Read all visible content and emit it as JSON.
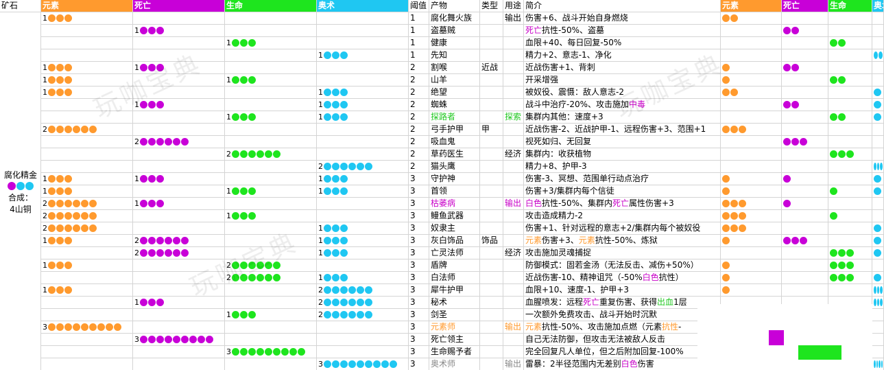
{
  "colors": {
    "yuansu": "#ff9a2e",
    "siwang": "#c800d8",
    "shengming": "#1ee51e",
    "aoshu": "#1fc7f2",
    "header_yuansu": "#ff9a2e",
    "header_siwang": "#c800d8",
    "header_shengming": "#1ee51e",
    "header_aoshu": "#1fc7f2"
  },
  "headers": {
    "ore": "矿石",
    "yuansu": "元素",
    "siwang": "死亡",
    "shengming": "生命",
    "aoshu": "奥术",
    "threshold": "阈值",
    "product": "产物",
    "type": "类型",
    "use": "用途",
    "desc": "简介",
    "r_yuansu": "元素",
    "r_siwang": "死亡",
    "r_shengming": "生命",
    "r_aoshu": "奥术"
  },
  "ore": {
    "name": "腐化精金",
    "combine_label": "合成：",
    "combine_value": "4山铜"
  },
  "watermark": "玩咖宝典",
  "rows": [
    {
      "e": 1,
      "d": 0,
      "l": 0,
      "a": 0,
      "t": "1",
      "p": "腐化舞火族",
      "pc": "",
      "ty": "",
      "u": "输出",
      "uc": "",
      "ds": [
        [
          "伤害+6、战斗开始自身燃烧",
          ""
        ]
      ],
      "re": 2,
      "rd": 0,
      "rl": 0,
      "ra": 0
    },
    {
      "e": 0,
      "d": 1,
      "l": 0,
      "a": 0,
      "t": "1",
      "p": "盗墓贼",
      "pc": "",
      "ty": "",
      "u": "",
      "uc": "",
      "ds": [
        [
          "死亡",
          "purple"
        ],
        [
          "抗性-50%、盗墓",
          ""
        ]
      ],
      "re": 0,
      "rd": 2,
      "rl": 0,
      "ra": 0
    },
    {
      "e": 0,
      "d": 0,
      "l": 1,
      "a": 0,
      "t": "1",
      "p": "健康",
      "pc": "",
      "ty": "",
      "u": "",
      "uc": "",
      "ds": [
        [
          "血限+40、每日回复-50%",
          ""
        ]
      ],
      "re": 0,
      "rd": 0,
      "rl": 2,
      "ra": 0
    },
    {
      "e": 0,
      "d": 0,
      "l": 0,
      "a": 1,
      "t": "1",
      "p": "先知",
      "pc": "",
      "ty": "",
      "u": "",
      "uc": "",
      "ds": [
        [
          "精力+2、意志-1、净化",
          ""
        ]
      ],
      "re": 0,
      "rd": 0,
      "rl": 0,
      "ra": 2
    },
    {
      "e": 1,
      "d": 1,
      "l": 0,
      "a": 0,
      "t": "2",
      "p": "割喉",
      "pc": "",
      "ty": "近战",
      "u": "",
      "uc": "",
      "ds": [
        [
          "近战伤害+1、背刺",
          ""
        ]
      ],
      "re": 1,
      "rd": 2,
      "rl": 0,
      "ra": 0
    },
    {
      "e": 1,
      "d": 0,
      "l": 1,
      "a": 0,
      "t": "2",
      "p": "山羊",
      "pc": "",
      "ty": "",
      "u": "",
      "uc": "",
      "ds": [
        [
          "开采增强",
          ""
        ]
      ],
      "re": 1,
      "rd": 0,
      "rl": 2,
      "ra": 0
    },
    {
      "e": 1,
      "d": 0,
      "l": 0,
      "a": 1,
      "t": "2",
      "p": "绝望",
      "pc": "",
      "ty": "",
      "u": "",
      "uc": "",
      "ds": [
        [
          "被奴役、震慑：敌人意志-2",
          ""
        ]
      ],
      "re": 2,
      "rd": 0,
      "rl": 0,
      "ra": 1
    },
    {
      "e": 0,
      "d": 1,
      "l": 0,
      "a": 1,
      "t": "2",
      "p": "蜘蛛",
      "pc": "",
      "ty": "",
      "u": "",
      "uc": "",
      "ds": [
        [
          "战斗中治疗-20%、攻击施加",
          ""
        ],
        [
          "中毒",
          "purple"
        ]
      ],
      "re": 0,
      "rd": 2,
      "rl": 0,
      "ra": 1
    },
    {
      "e": 0,
      "d": 0,
      "l": 1,
      "a": 1,
      "t": "2",
      "p": "探路者",
      "pc": "green",
      "ty": "",
      "u": "探索",
      "uc": "green",
      "ds": [
        [
          "集群内其他：速度+3",
          ""
        ]
      ],
      "re": 0,
      "rd": 0,
      "rl": 2,
      "ra": 1
    },
    {
      "e": 2,
      "d": 0,
      "l": 0,
      "a": 0,
      "t": "2",
      "p": "弓手护甲",
      "pc": "",
      "ty": "甲",
      "u": "",
      "uc": "",
      "ds": [
        [
          "近战伤害-2、近战护甲-1、远程伤害+3、范围+1",
          ""
        ]
      ],
      "re": 3,
      "rd": 0,
      "rl": 0,
      "ra": 0
    },
    {
      "e": 0,
      "d": 2,
      "l": 0,
      "a": 0,
      "t": "2",
      "p": "吸血鬼",
      "pc": "",
      "ty": "",
      "u": "",
      "uc": "",
      "ds": [
        [
          "视死如归、无回复",
          ""
        ]
      ],
      "re": 0,
      "rd": 3,
      "rl": 0,
      "ra": 0
    },
    {
      "e": 0,
      "d": 0,
      "l": 2,
      "a": 0,
      "t": "2",
      "p": "草药医生",
      "pc": "",
      "ty": "",
      "u": "经济",
      "uc": "",
      "ds": [
        [
          "集群内：收获植物",
          ""
        ]
      ],
      "re": 0,
      "rd": 0,
      "rl": 3,
      "ra": 0
    },
    {
      "e": 0,
      "d": 0,
      "l": 0,
      "a": 2,
      "t": "2",
      "p": "猫头鹰",
      "pc": "",
      "ty": "",
      "u": "",
      "uc": "",
      "ds": [
        [
          "精力+8、护甲-3",
          ""
        ]
      ],
      "re": 0,
      "rd": 0,
      "rl": 0,
      "ra": 3
    },
    {
      "e": 1,
      "d": 1,
      "l": 0,
      "a": 1,
      "t": "3",
      "p": "守护神",
      "pc": "",
      "ty": "",
      "u": "",
      "uc": "",
      "ds": [
        [
          "伤害-3、冥想、范围单行动点治疗",
          ""
        ]
      ],
      "re": 1,
      "rd": 1,
      "rl": 0,
      "ra": 1
    },
    {
      "e": 1,
      "d": 0,
      "l": 1,
      "a": 1,
      "t": "3",
      "p": "首领",
      "pc": "",
      "ty": "",
      "u": "",
      "uc": "",
      "ds": [
        [
          "伤害+3/集群内每个信徒",
          ""
        ]
      ],
      "re": 1,
      "rd": 0,
      "rl": 1,
      "ra": 1
    },
    {
      "e": 2,
      "d": 1,
      "l": 0,
      "a": 0,
      "t": "3",
      "p": "枯萎病",
      "pc": "purple",
      "ty": "",
      "u": "输出",
      "uc": "purple",
      "ds": [
        [
          "白色",
          "purple"
        ],
        [
          "抗性-50%、集群内",
          ""
        ],
        [
          "死亡",
          "purple"
        ],
        [
          "属性伤害+3",
          ""
        ]
      ],
      "re": 3,
      "rd": 1,
      "rl": 0,
      "ra": 0
    },
    {
      "e": 2,
      "d": 0,
      "l": 1,
      "a": 0,
      "t": "3",
      "p": "鳗鱼武器",
      "pc": "",
      "ty": "",
      "u": "",
      "uc": "",
      "ds": [
        [
          "攻击造成精力-2",
          ""
        ]
      ],
      "re": 3,
      "rd": 0,
      "rl": 1,
      "ra": 0
    },
    {
      "e": 2,
      "d": 0,
      "l": 0,
      "a": 1,
      "t": "3",
      "p": "奴隶主",
      "pc": "",
      "ty": "",
      "u": "",
      "uc": "",
      "ds": [
        [
          "伤害+1、针对远程的意志+2/集群内每个被奴役",
          ""
        ]
      ],
      "re": 3,
      "rd": 0,
      "rl": 0,
      "ra": 1
    },
    {
      "e": 1,
      "d": 2,
      "l": 0,
      "a": 1,
      "t": "3",
      "p": "灰白饰品",
      "pc": "",
      "ty": "饰品",
      "u": "",
      "uc": "",
      "ds": [
        [
          "元素",
          "orange"
        ],
        [
          "伤害+3、",
          ""
        ],
        [
          "元素",
          "orange"
        ],
        [
          "抗性-50%、炼狱",
          ""
        ]
      ],
      "re": 1,
      "rd": 3,
      "rl": 0,
      "ra": 1
    },
    {
      "e": 0,
      "d": 2,
      "l": 0,
      "a": 1,
      "t": "3",
      "p": "亡灵法师",
      "pc": "",
      "ty": "",
      "u": "经济",
      "uc": "",
      "ds": [
        [
          "攻击施加灵魂捕捉",
          ""
        ]
      ],
      "re": 0,
      "rd": 0,
      "rl": 3,
      "ra": 1
    },
    {
      "e": 1,
      "d": 0,
      "l": 2,
      "a": 0,
      "t": "3",
      "p": "盾牌",
      "pc": "",
      "ty": "",
      "u": "",
      "uc": "",
      "ds": [
        [
          "防御模式：固若金汤（无法反击、减伤+50%）",
          ""
        ]
      ],
      "re": 1,
      "rd": 0,
      "rl": 3,
      "ra": 0
    },
    {
      "e": 0,
      "d": 0,
      "l": 2,
      "a": 1,
      "t": "3",
      "p": "白法师",
      "pc": "",
      "ty": "",
      "u": "",
      "uc": "",
      "ds": [
        [
          "近战伤害-10、精神诅咒（-50%",
          ""
        ],
        [
          "白色",
          "purple"
        ],
        [
          "抗性）",
          ""
        ]
      ],
      "re": 1,
      "rd": 0,
      "rl": 3,
      "ra": 1
    },
    {
      "e": 1,
      "d": 0,
      "l": 0,
      "a": 2,
      "t": "3",
      "p": "犀牛护甲",
      "pc": "",
      "ty": "",
      "u": "",
      "uc": "",
      "ds": [
        [
          "血限+10、速度-1、护甲+3",
          ""
        ]
      ],
      "re": 1,
      "rd": 0,
      "rl": 0,
      "ra": 3
    },
    {
      "e": 0,
      "d": 1,
      "l": 0,
      "a": 2,
      "t": "3",
      "p": "秘术",
      "pc": "",
      "ty": "",
      "u": "",
      "uc": "",
      "ds": [
        [
          "血腥喷发：远程",
          ""
        ],
        [
          "死亡",
          "purple"
        ],
        [
          "重复伤害、获得",
          ""
        ],
        [
          "出血",
          "green"
        ],
        [
          "1层",
          ""
        ]
      ],
      "re": 0,
      "rd": 0,
      "rl": 0,
      "ra": 3
    },
    {
      "e": 0,
      "d": 0,
      "l": 1,
      "a": 2,
      "t": "3",
      "p": "剑圣",
      "pc": "",
      "ty": "",
      "u": "",
      "uc": "",
      "ds": [
        [
          "一次额外免费攻击、战斗开始时沉默",
          ""
        ]
      ],
      "re": 0,
      "rd": 0,
      "rl": 0,
      "ra": 0
    },
    {
      "e": 3,
      "d": 0,
      "l": 0,
      "a": 0,
      "t": "3",
      "p": "元素师",
      "pc": "orange",
      "ty": "",
      "u": "输出",
      "uc": "orange",
      "ds": [
        [
          "元素",
          "orange"
        ],
        [
          "抗性-50%、攻击施加点燃（元素",
          ""
        ],
        [
          "抗性",
          "orange"
        ],
        [
          "-",
          ""
        ]
      ],
      "re": 0,
      "rd": 0,
      "rl": 0,
      "ra": 0
    },
    {
      "e": 0,
      "d": 3,
      "l": 0,
      "a": 0,
      "t": "3",
      "p": "死亡领主",
      "pc": "",
      "ty": "",
      "u": "",
      "uc": "",
      "ds": [
        [
          "自己无法防御，但攻击无法被敌人反击",
          ""
        ]
      ],
      "re": 0,
      "rd": 0,
      "rl": 0,
      "ra": 0
    },
    {
      "e": 0,
      "d": 0,
      "l": 3,
      "a": 0,
      "t": "3",
      "p": "生命赐予者",
      "pc": "",
      "ty": "",
      "u": "",
      "uc": "",
      "ds": [
        [
          "完全回复凡人单位，但之后附加回复-100%",
          ""
        ]
      ],
      "re": 0,
      "rd": 0,
      "rl": 0,
      "ra": 0
    },
    {
      "e": 0,
      "d": 0,
      "l": 0,
      "a": 3,
      "t": "3",
      "p": "奥术师",
      "pc": "gray",
      "ty": "",
      "u": "输出",
      "uc": "gray",
      "ds": [
        [
          "雷暴：2半径范围内无差别",
          ""
        ],
        [
          "白色",
          "purple"
        ],
        [
          "伤害",
          ""
        ]
      ],
      "re": 0,
      "rd": 0,
      "rl": 0,
      "ra": 4
    }
  ]
}
